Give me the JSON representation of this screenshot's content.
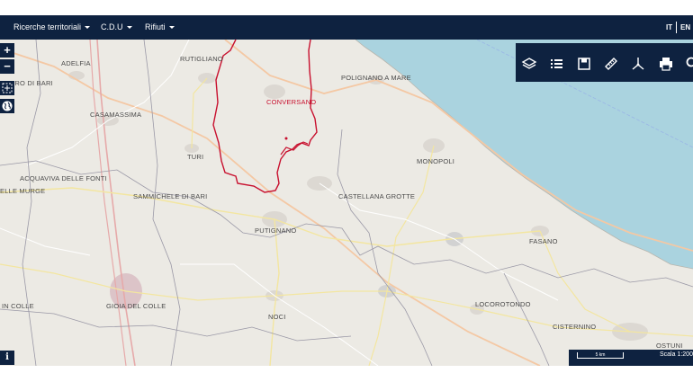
{
  "topbar": {
    "menus": [
      {
        "label": "Ricerche territoriali"
      },
      {
        "label": "C.D.U"
      },
      {
        "label": "Rifiuti"
      }
    ],
    "lang_it": "IT",
    "lang_en": "EN"
  },
  "map": {
    "places": [
      "RUTIGLIANO",
      "ADELFIA",
      "ANDRO DI BARI",
      "CASAMASSIMA",
      "CONVERSANO",
      "POLIGNANO A MARE",
      "CASTELLANA GROTTE",
      "MONOPOLI",
      "TURI",
      "ACQUAVIVA DELLE FONTI",
      "SAMMICHELE DI BARI",
      "ELLE MURGE",
      "PUTIGNANO",
      "FASANO",
      "IN COLLE",
      "GIOIA DEL COLLE",
      "NOCI",
      "LOCOROTONDO",
      "CISTERNINO",
      "OSTUNI"
    ],
    "highlighted_place": "CONVERSANO",
    "zoom_in": "+",
    "zoom_out": "−",
    "info": "i"
  },
  "tools": [
    {
      "icon": "layers-icon"
    },
    {
      "icon": "list-icon"
    },
    {
      "icon": "save-icon"
    },
    {
      "icon": "ruler-icon"
    },
    {
      "icon": "coordinates-icon"
    },
    {
      "icon": "print-icon"
    },
    {
      "icon": "search-icon"
    }
  ],
  "scale": {
    "bar_label": "5 km",
    "text": "Scala 1:200"
  },
  "colors": {
    "navbar": "#0e2240",
    "sea": "#aad3df",
    "land": "#eceae4",
    "boundary": "#c8102e"
  }
}
